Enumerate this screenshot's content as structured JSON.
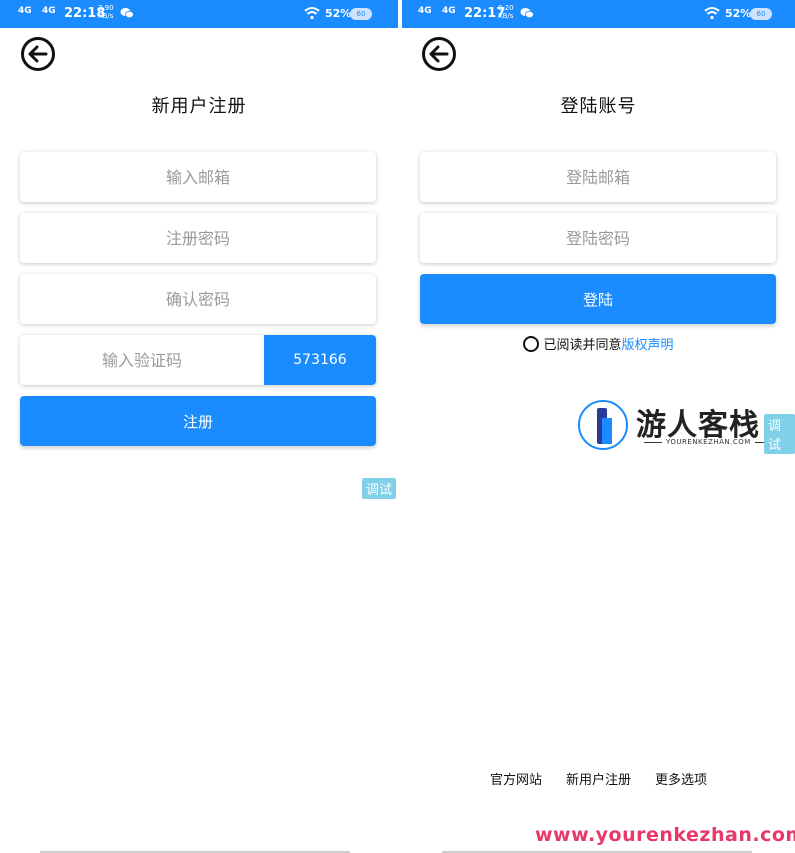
{
  "left_screen": {
    "status": {
      "network1": "4G",
      "network2": "4G",
      "time": "22:18",
      "speed": "3.90 KB/s",
      "battery_pct": "52%",
      "battery_label": "60"
    },
    "title": "新用户注册",
    "fields": {
      "email_placeholder": "输入邮箱",
      "password_placeholder": "注册密码",
      "confirm_placeholder": "确认密码",
      "code_placeholder": "输入验证码"
    },
    "captcha_code": "573166",
    "register_button": "注册",
    "debug_label": "调试"
  },
  "right_screen": {
    "status": {
      "network1": "4G",
      "network2": "4G",
      "time": "22:17",
      "speed": "0.20 KB/s",
      "battery_pct": "52%",
      "battery_label": "60"
    },
    "title": "登陆账号",
    "fields": {
      "email_placeholder": "登陆邮箱",
      "password_placeholder": "登陆密码"
    },
    "login_button": "登陆",
    "agreement": {
      "text": "已阅读并同意",
      "link": "版权声明"
    },
    "debug_label": "调试",
    "bottom_links": [
      "官方网站",
      "新用户注册",
      "更多选项"
    ]
  },
  "watermark": {
    "name": "游人客栈",
    "sub": "YOURENKEZHAN.COM",
    "url": "www.yourenkezhan.com"
  },
  "colors": {
    "accent": "#1a8cff",
    "debug_tag": "#7fd0e8",
    "watermark_url": "#e8386a"
  }
}
